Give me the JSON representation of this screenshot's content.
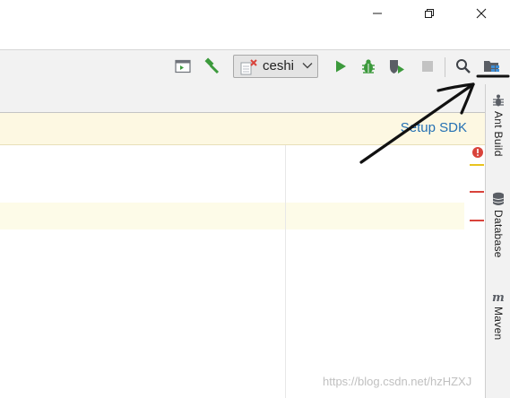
{
  "window": {
    "minimize_icon": "minimize-icon",
    "maximize_icon": "restore-icon",
    "close_icon": "close-icon"
  },
  "toolbar": {
    "run_config_label": "ceshi",
    "icons": [
      "terminal-icon",
      "build-hammer-icon",
      "run-icon",
      "debug-icon",
      "coverage-icon",
      "stop-icon",
      "search-icon",
      "project-structure-icon"
    ]
  },
  "banner": {
    "link_label": "Setup SDK",
    "background": "#fdf8e2"
  },
  "tool_windows": [
    {
      "label": "Ant Build",
      "icon": "ant-icon"
    },
    {
      "label": "Database",
      "icon": "database-icon"
    },
    {
      "label": "Maven",
      "icon": "maven-icon"
    }
  ],
  "colors": {
    "run_green": "#3c9a3c",
    "error_red": "#d9433b",
    "warning_yellow": "#e8c31f",
    "link_blue": "#2470b3"
  },
  "watermark": "https://blog.csdn.net/hzHZXJ"
}
